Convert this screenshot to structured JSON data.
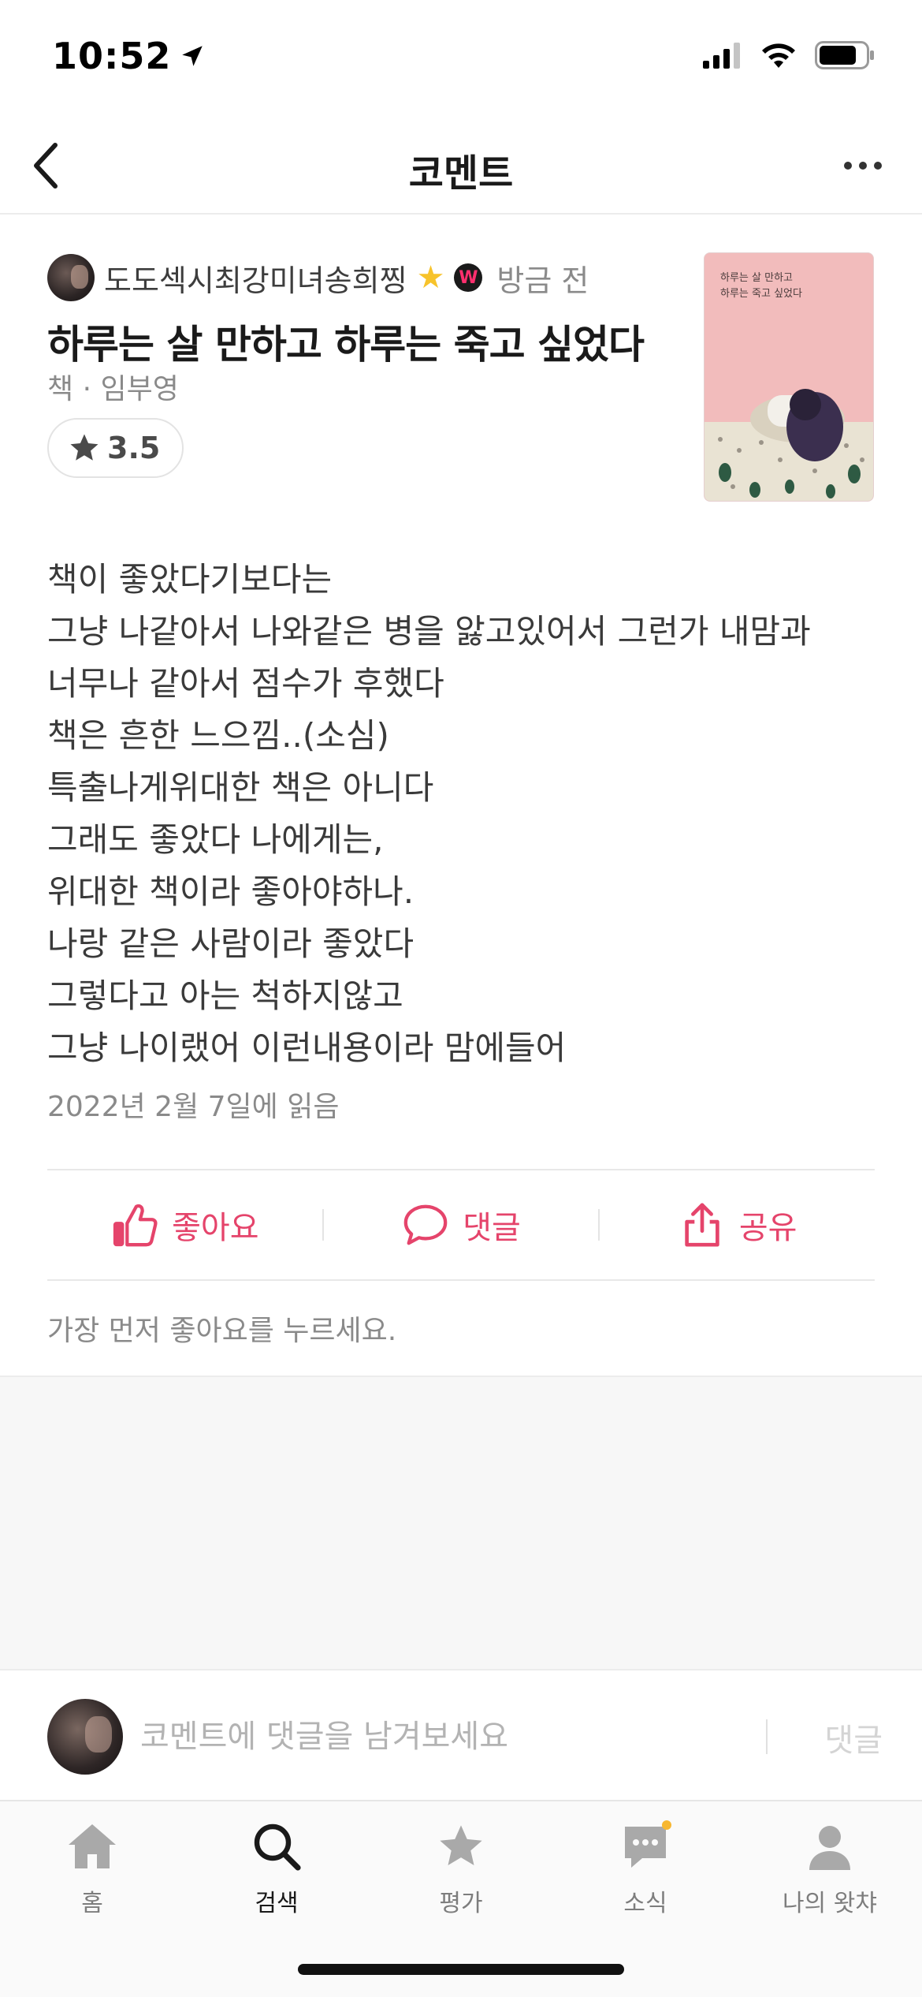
{
  "status_bar": {
    "time": "10:52"
  },
  "header": {
    "title": "코멘트"
  },
  "comment": {
    "author_name": "도도섹시최강미녀송희찡",
    "badge_letter": "W",
    "time_ago": "방금 전",
    "book_title": "하루는 살 만하고 하루는 죽고 싶었다",
    "book_meta": "책 · 임부영",
    "rating": "3.5",
    "cover": {
      "title_line1": "하루는 살 만하고",
      "title_line2": "하루는 죽고 싶었다",
      "bg_color": "#f2bcbc"
    },
    "body_lines": [
      "책이 좋았다기보다는",
      "그냥 나같아서 나와같은 병을 앓고있어서 그런가 내맘과",
      "너무나 같아서 점수가 후했다",
      "책은 흔한 느으낌..(소심)",
      "특출나게위대한 책은 아니다",
      "그래도 좋았다 나에게는,",
      "위대한 책이라 좋아야하나.",
      "나랑 같은 사람이라 좋았다",
      "그렇다고 아는 척하지않고",
      "그냥 나이랬어 이런내용이라 맘에들어"
    ],
    "read_date": "2022년 2월 7일에 읽음"
  },
  "actions": {
    "like_label": "좋아요",
    "comment_label": "댓글",
    "share_label": "공유",
    "accent_color": "#e5446b"
  },
  "like_prompt": "가장 먼저 좋아요를 누르세요.",
  "reply": {
    "placeholder": "코멘트에 댓글을 남겨보세요",
    "submit_label": "댓글"
  },
  "tabs": [
    {
      "label": "홈",
      "icon": "home-icon",
      "active": false
    },
    {
      "label": "검색",
      "icon": "search-icon",
      "active": true
    },
    {
      "label": "평가",
      "icon": "star-icon",
      "active": false
    },
    {
      "label": "소식",
      "icon": "chat-icon",
      "active": false,
      "has_notification": true
    },
    {
      "label": "나의 왓챠",
      "icon": "person-icon",
      "active": false
    }
  ]
}
